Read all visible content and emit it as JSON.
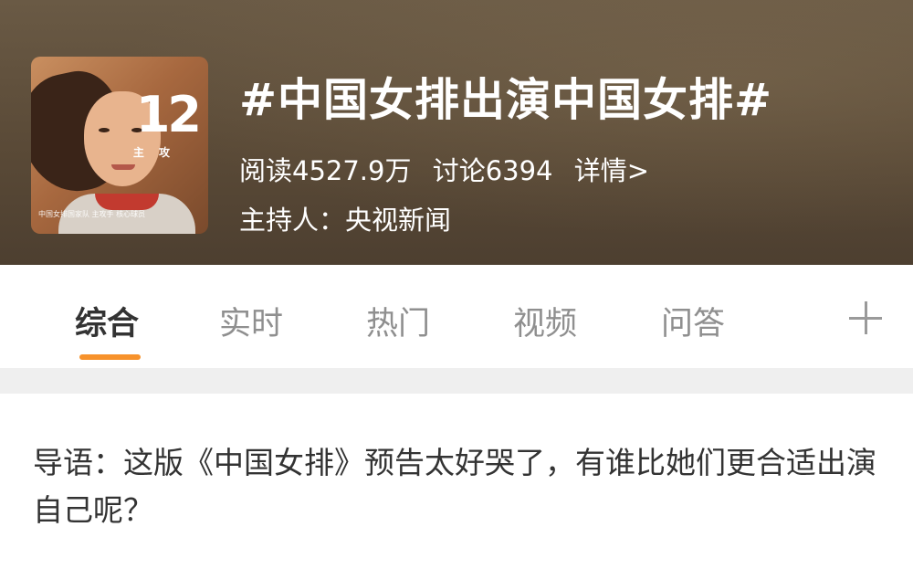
{
  "topic": {
    "thumbnail": {
      "number": "12",
      "position": "主 攻",
      "caption": "中国女排国家队 主攻手 核心球员"
    },
    "title": "#中国女排出演中国女排#",
    "reads": "阅读4527.9万",
    "discussions": "讨论6394",
    "details_link": "详情>",
    "host": "主持人：央视新闻"
  },
  "tabs": {
    "items": [
      {
        "label": "综合"
      },
      {
        "label": "实时"
      },
      {
        "label": "热门"
      },
      {
        "label": "视频"
      },
      {
        "label": "问答"
      }
    ],
    "active_index": 0,
    "accent_color": "#f7922b",
    "add_icon": "plus-icon"
  },
  "intro": {
    "text": "导语：这版《中国女排》预告太好哭了，有谁比她们更合适出演自己呢？"
  }
}
